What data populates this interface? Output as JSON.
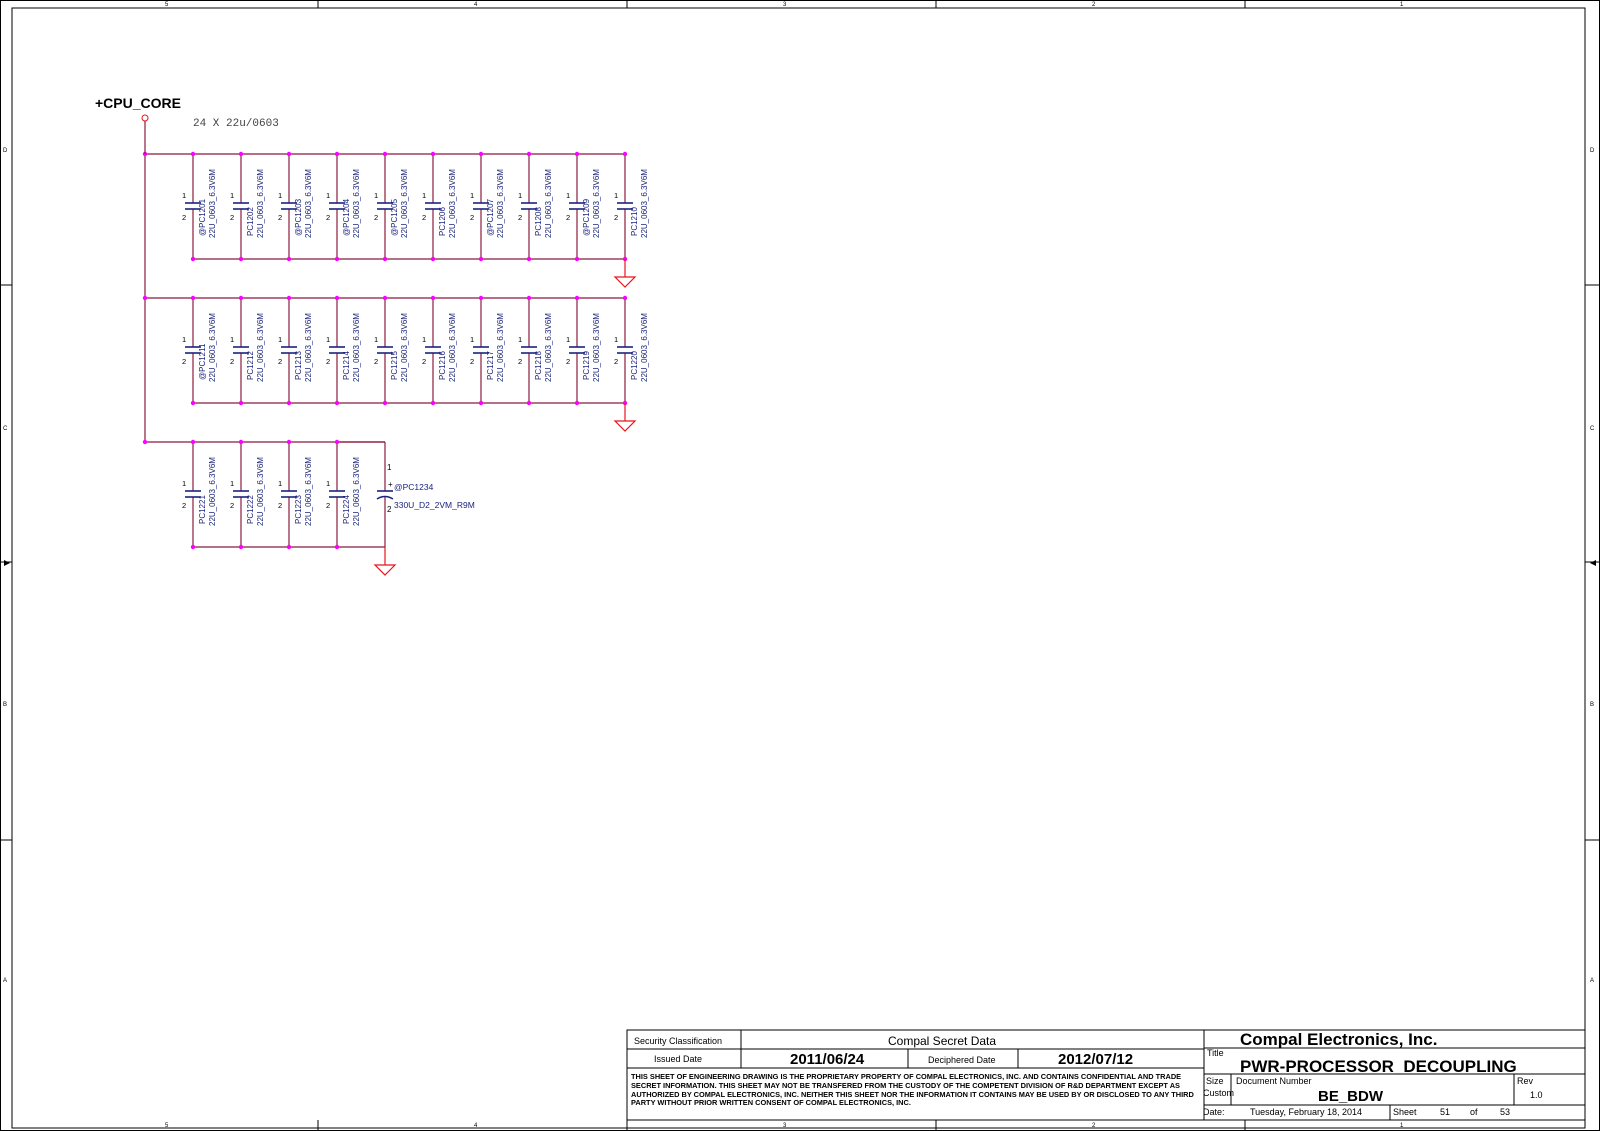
{
  "zone_columns": [
    "5",
    "4",
    "3",
    "2",
    "1"
  ],
  "zone_rows": [
    "D",
    "C",
    "B",
    "A"
  ],
  "net": {
    "name": "+CPU_CORE",
    "note": "24 X 22u/0603"
  },
  "capacitors": [
    {
      "ref": "@PC1201",
      "value": "22U_0603_6.3V6M"
    },
    {
      "ref": "PC1202",
      "value": "22U_0603_6.3V6M"
    },
    {
      "ref": "@PC1203",
      "value": "22U_0603_6.3V6M"
    },
    {
      "ref": "@PC1204",
      "value": "22U_0603_6.3V6M"
    },
    {
      "ref": "@PC1205",
      "value": "22U_0603_6.3V6M"
    },
    {
      "ref": "PC1206",
      "value": "22U_0603_6.3V6M"
    },
    {
      "ref": "@PC1207",
      "value": "22U_0603_6.3V6M"
    },
    {
      "ref": "PC1208",
      "value": "22U_0603_6.3V6M"
    },
    {
      "ref": "@PC1209",
      "value": "22U_0603_6.3V6M"
    },
    {
      "ref": "PC1210",
      "value": "22U_0603_6.3V6M"
    },
    {
      "ref": "@PC1211",
      "value": "22U_0603_6.3V6M"
    },
    {
      "ref": "PC1212",
      "value": "22U_0603_6.3V6M"
    },
    {
      "ref": "PC1213",
      "value": "22U_0603_6.3V6M"
    },
    {
      "ref": "PC1214",
      "value": "22U_0603_6.3V6M"
    },
    {
      "ref": "PC1215",
      "value": "22U_0603_6.3V6M"
    },
    {
      "ref": "PC1216",
      "value": "22U_0603_6.3V6M"
    },
    {
      "ref": "PC1217",
      "value": "22U_0603_6.3V6M"
    },
    {
      "ref": "PC1218",
      "value": "22U_0603_6.3V6M"
    },
    {
      "ref": "PC1219",
      "value": "22U_0603_6.3V6M"
    },
    {
      "ref": "PC1220",
      "value": "22U_0603_6.3V6M"
    },
    {
      "ref": "PC1221",
      "value": "22U_0603_6.3V6M"
    },
    {
      "ref": "PC1222",
      "value": "22U_0603_6.3V6M"
    },
    {
      "ref": "PC1223",
      "value": "22U_0603_6.3V6M"
    },
    {
      "ref": "PC1224",
      "value": "22U_0603_6.3V6M"
    }
  ],
  "bulk_cap": {
    "ref": "@PC1234",
    "value": "330U_D2_2VM_R9M",
    "pin1": "1",
    "pin2": "2",
    "plus": "+"
  },
  "pin_labels": {
    "pin1": "1",
    "pin2": "2"
  },
  "title_block": {
    "security_label": "Security Classification",
    "security_value": "Compal Secret Data",
    "issued_label": "Issued Date",
    "issued_value": "2011/06/24",
    "deciphered_label": "Deciphered Date",
    "deciphered_value": "2012/07/12",
    "company": "Compal Electronics, Inc.",
    "title_label": "Title",
    "title": "PWR-PROCESSOR_DECOUPLING",
    "size_label": "Size",
    "size_value": "Custom",
    "docnum_label": "Document Number",
    "docnum": "BE_BDW",
    "rev_label": "Rev",
    "rev": "1.0",
    "date_label": "Date:",
    "date": "Tuesday, February 18, 2014",
    "sheet_label": "Sheet",
    "sheet": "51",
    "of_label": "of",
    "sheet_total": "53",
    "notice": "THIS SHEET OF ENGINEERING DRAWING IS THE PROPRIETARY PROPERTY OF COMPAL ELECTRONICS, INC. AND CONTAINS CONFIDENTIAL AND TRADE SECRET INFORMATION. THIS SHEET MAY NOT BE TRANSFERED FROM THE CUSTODY OF THE COMPETENT DIVISION OF R&D DEPARTMENT EXCEPT AS AUTHORIZED BY COMPAL ELECTRONICS, INC. NEITHER THIS SHEET NOR THE INFORMATION IT CONTAINS MAY BE USED BY OR DISCLOSED TO ANY THIRD PARTY WITHOUT PRIOR WRITTEN CONSENT OF COMPAL ELECTRONICS, INC."
  },
  "colors": {
    "wire": "#8b1a3c",
    "junction": "#ff00ff",
    "ground": "#e8141c",
    "part": "#1a237e",
    "text": "#000000"
  }
}
